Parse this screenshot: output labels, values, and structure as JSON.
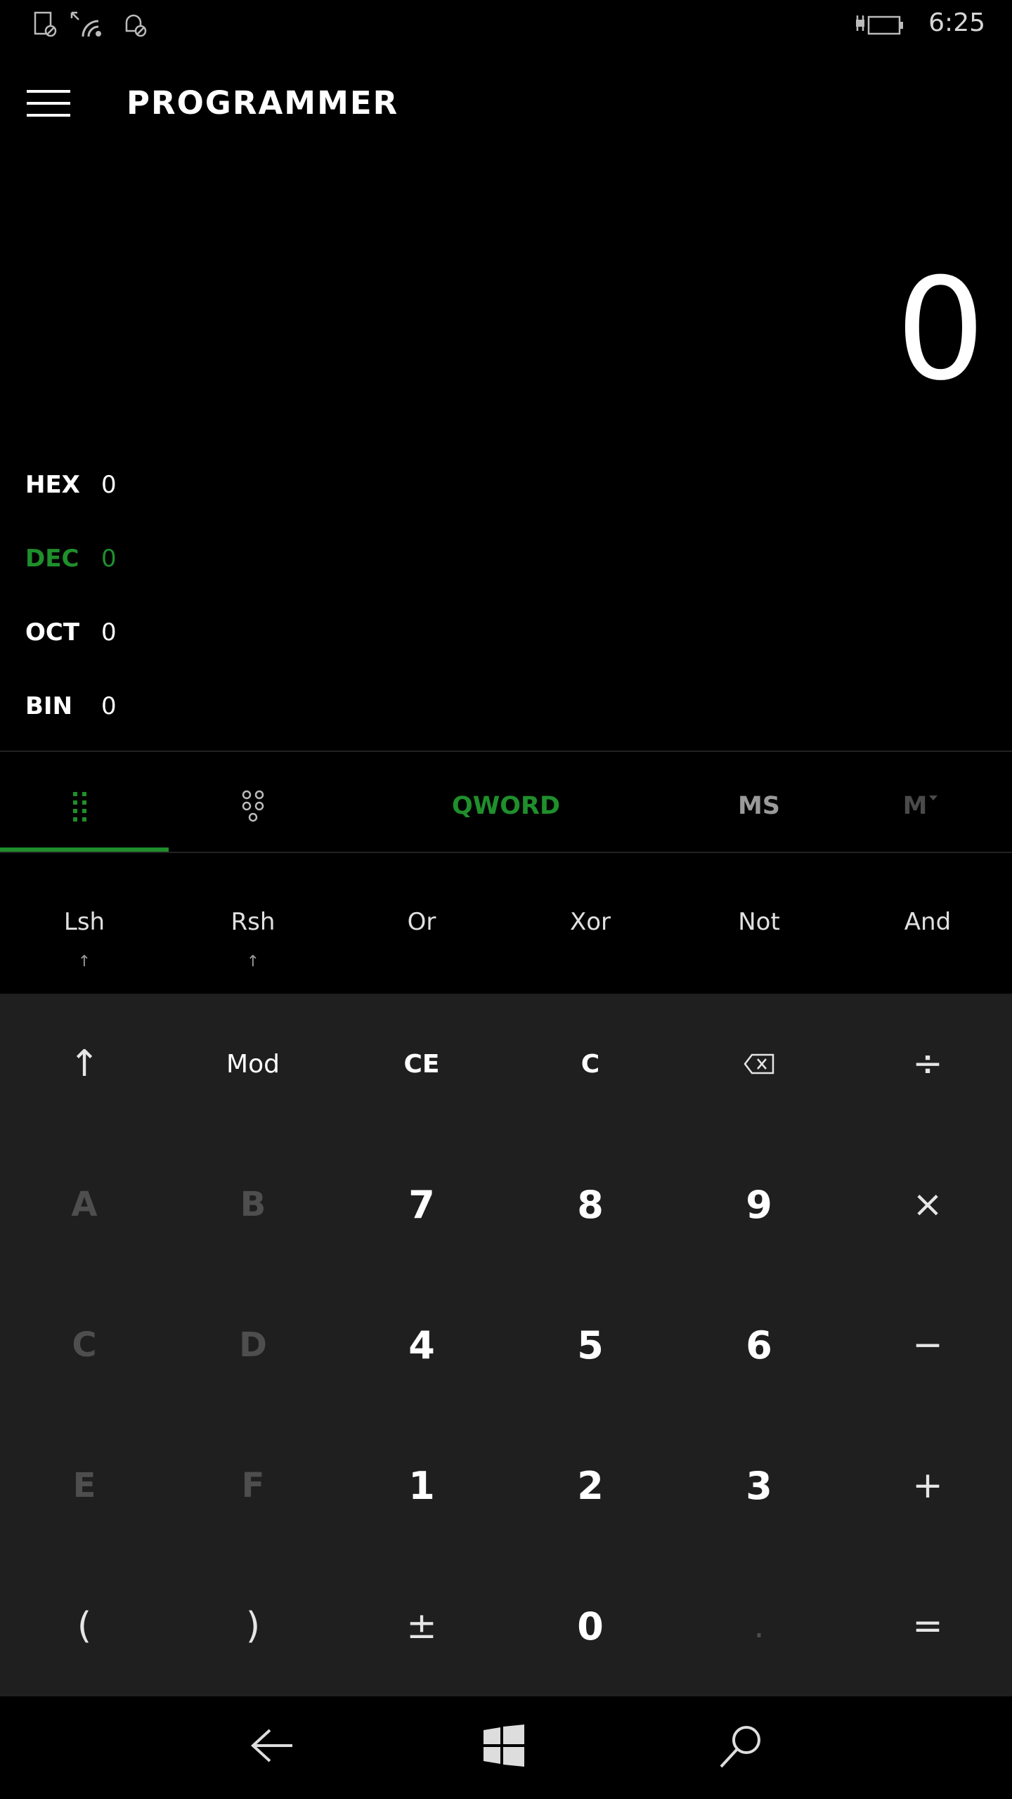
{
  "status": {
    "time": "6:25"
  },
  "header": {
    "title": "PROGRAMMER"
  },
  "display": {
    "value": "0"
  },
  "radix": [
    {
      "label": "HEX",
      "value": "0"
    },
    {
      "label": "DEC",
      "value": "0"
    },
    {
      "label": "OCT",
      "value": "0"
    },
    {
      "label": "BIN",
      "value": "0"
    }
  ],
  "tabs": {
    "word_size": "QWORD",
    "memory_store": "MS",
    "memory": "M"
  },
  "bitwise": [
    {
      "label": "Lsh",
      "sup": "↑"
    },
    {
      "label": "Rsh",
      "sup": "↑"
    },
    {
      "label": "Or"
    },
    {
      "label": "Xor"
    },
    {
      "label": "Not"
    },
    {
      "label": "And"
    }
  ],
  "keys": {
    "row1": [
      "↑",
      "Mod",
      "CE",
      "C",
      "⌫",
      "÷"
    ],
    "row2": [
      "A",
      "B",
      "7",
      "8",
      "9",
      "×"
    ],
    "row3": [
      "C",
      "D",
      "4",
      "5",
      "6",
      "−"
    ],
    "row4": [
      "E",
      "F",
      "1",
      "2",
      "3",
      "+"
    ],
    "row5": [
      "(",
      ")",
      "±",
      "0",
      ".",
      "="
    ]
  },
  "colors": {
    "accent": "#1f8f2c",
    "keypad_bg": "#1f1f1f"
  }
}
